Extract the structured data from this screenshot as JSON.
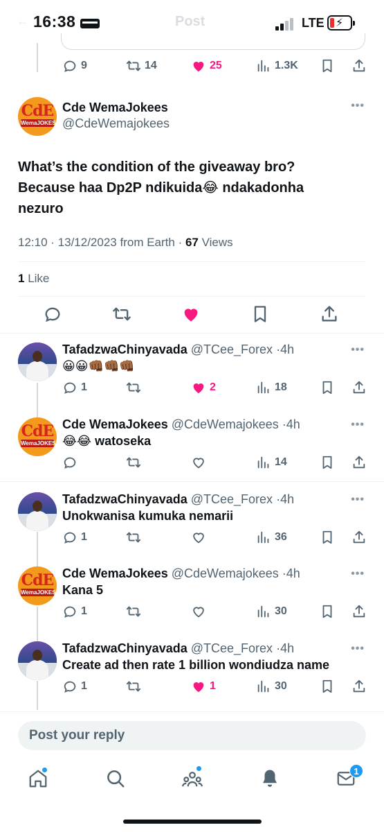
{
  "status_bar": {
    "time": "16:38",
    "network": "LTE"
  },
  "header": {
    "ghost_title": "Post",
    "ghost_back": "←"
  },
  "parent_actions": {
    "replies": "9",
    "reposts": "14",
    "likes": "25",
    "views": "1.3K"
  },
  "main_tweet": {
    "name": "Cde WemaJokees",
    "handle": "@CdeWemajokees",
    "avatar_text": "CdE",
    "avatar_subtext": "WemaJOKES",
    "text_line1": "What’s the condition of the giveaway bro?",
    "text_line2": "Because haa Dp2P ndikuida😂 ndakadonha",
    "text_line3": "nezuro",
    "time": "12:10",
    "date": "13/12/2023",
    "source": "from Earth",
    "views_count": "67",
    "views_label": "Views",
    "likes_count": "1",
    "likes_label": "Like"
  },
  "replies": [
    {
      "name": "TafadzwaChinyavada",
      "handle": "@TCee_Forex",
      "age": "4h",
      "text": "😀😀👊🏾👊🏾👊🏾",
      "replies": "1",
      "reposts": "",
      "likes": "2",
      "liked": true,
      "views": "18"
    },
    {
      "name": "Cde WemaJokees",
      "handle": "@CdeWemajokees",
      "age": "4h",
      "text": "😂😂 watoseka",
      "replies": "",
      "reposts": "",
      "likes": "",
      "liked": false,
      "views": "14"
    },
    {
      "name": "TafadzwaChinyavada",
      "handle": "@TCee_Forex",
      "age": "4h",
      "text": "Unokwanisa kumuka nemarii",
      "replies": "1",
      "reposts": "",
      "likes": "",
      "liked": false,
      "views": "36"
    },
    {
      "name": "Cde WemaJokees",
      "handle": "@CdeWemajokees",
      "age": "4h",
      "text": "Kana 5",
      "replies": "1",
      "reposts": "",
      "likes": "",
      "liked": false,
      "views": "30"
    },
    {
      "name": "TafadzwaChinyavada",
      "handle": "@TCee_Forex",
      "age": "4h",
      "text": "Create ad then rate 1 billion wondiudza name",
      "replies": "1",
      "reposts": "",
      "likes": "1",
      "liked": true,
      "views": "30"
    }
  ],
  "reply_box": {
    "placeholder": "Post your reply"
  },
  "tabbar": {
    "messages_badge": "1"
  },
  "colors": {
    "like": "#f91880",
    "accent": "#1d9bf0",
    "muted": "#536471"
  }
}
